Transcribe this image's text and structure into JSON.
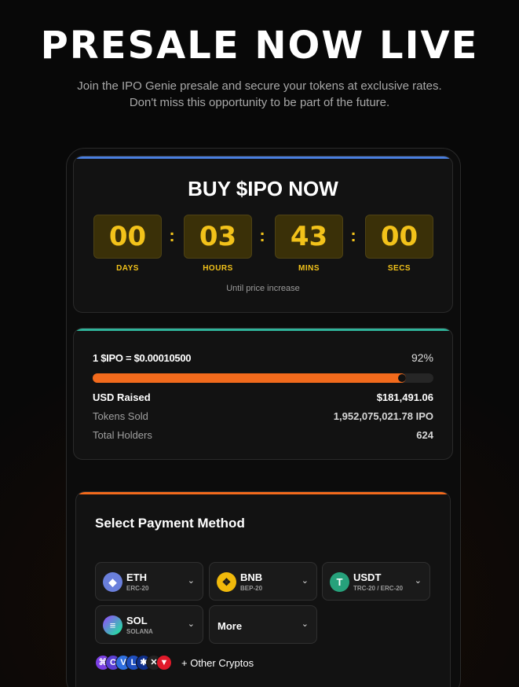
{
  "hero": {
    "title": "PRESALE NOW LIVE",
    "subtitle_line1": "Join the IPO Genie presale and secure your tokens at exclusive rates.",
    "subtitle_line2": "Don't miss this opportunity to be part of the future."
  },
  "countdown": {
    "title": "BUY $IPO NOW",
    "units": [
      {
        "value": "00",
        "label": "DAYS"
      },
      {
        "value": "03",
        "label": "HOURS"
      },
      {
        "value": "43",
        "label": "MINS"
      },
      {
        "value": "00",
        "label": "SECS"
      }
    ],
    "separator": ":",
    "caption": "Until price increase",
    "accent_color": "#f2c21a"
  },
  "stats": {
    "rate": "1 $IPO = $0.00010500",
    "percent_label": "92%",
    "progress_percent": 92,
    "usd_raised_label": "USD Raised",
    "usd_raised_value": "$181,491.06",
    "tokens_sold_label": "Tokens Sold",
    "tokens_sold_value": "1,952,075,021.78 IPO",
    "holders_label": "Total Holders",
    "holders_value": "624",
    "bar_color": "#f26a1c"
  },
  "payment": {
    "title": "Select Payment Method",
    "methods": [
      {
        "name": "ETH",
        "network": "ERC-20",
        "icon": "eth-icon"
      },
      {
        "name": "BNB",
        "network": "BEP-20",
        "icon": "bnb-icon"
      },
      {
        "name": "USDT",
        "network": "TRC-20 / ERC-20",
        "icon": "usdt-icon"
      },
      {
        "name": "SOL",
        "network": "SOLANA",
        "icon": "sol-icon"
      }
    ],
    "more_label": "More",
    "other_cryptos_label": "+ Other Cryptos"
  }
}
